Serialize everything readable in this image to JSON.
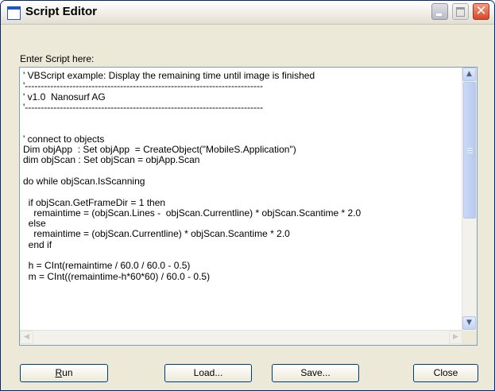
{
  "window": {
    "title": "Script Editor"
  },
  "editor": {
    "prompt": "Enter Script here:",
    "lines": [
      "' VBScript example: Display the remaining time until image is finished",
      "'---------------------------------------------------------------------------",
      "' v1.0  Nanosurf AG",
      "'---------------------------------------------------------------------------",
      "",
      "",
      "' connect to objects",
      "Dim objApp  : Set objApp  = CreateObject(\"MobileS.Application\")",
      "dim objScan : Set objScan = objApp.Scan",
      "",
      "do while objScan.IsScanning",
      "",
      "  if objScan.GetFrameDir = 1 then",
      "    remaintime = (objScan.Lines -  objScan.Currentline) * objScan.Scantime * 2.0",
      "  else",
      "    remaintime = (objScan.Currentline) * objScan.Scantime * 2.0",
      "  end if",
      "",
      "  h = CInt(remaintime / 60.0 / 60.0 - 0.5)",
      "  m = CInt((remaintime-h*60*60) / 60.0 - 0.5)"
    ]
  },
  "buttons": {
    "run_mnemonic": "R",
    "run_rest": "un",
    "load": "Load...",
    "save": "Save...",
    "close": "Close"
  },
  "icons": {
    "scroll_up": "chevron-up-icon",
    "scroll_down": "chevron-down-icon",
    "scroll_left": "chevron-left-icon",
    "scroll_right": "chevron-right-icon"
  }
}
